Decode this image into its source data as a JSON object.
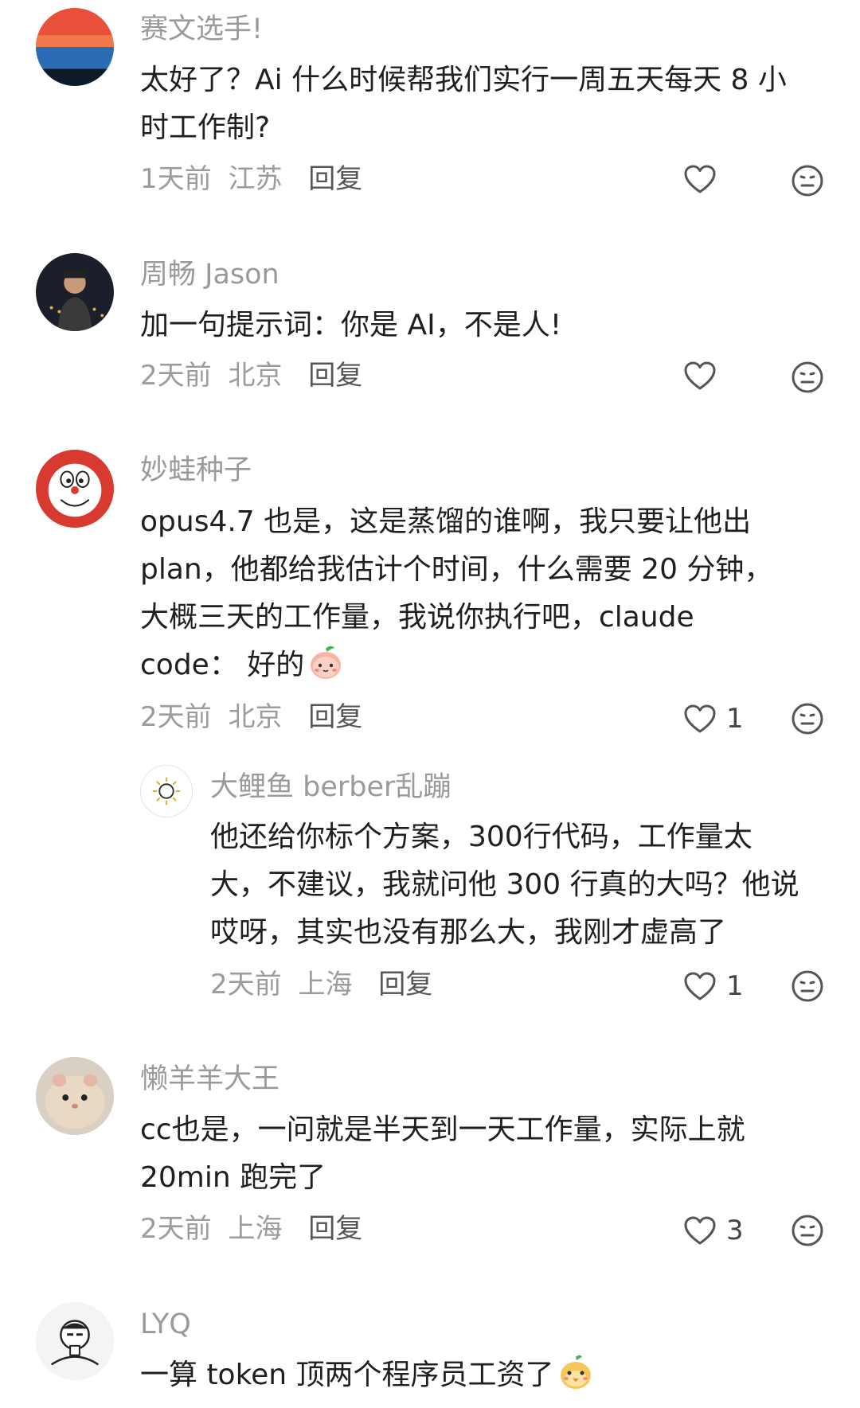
{
  "comments": [
    {
      "username": "赛文选手!",
      "content": "太好了？Ai 什么时候帮我们实行一周五天每天 8 小\n时工作制?",
      "time": "1天前",
      "location": "江苏",
      "reply_label": "回复",
      "likes": ""
    },
    {
      "username": "周畅 Jason",
      "content": "加一句提示词：你是 AI，不是人!",
      "time": "2天前",
      "location": "北京",
      "reply_label": "回复",
      "likes": ""
    },
    {
      "username": "妙蛙种子",
      "content": "opus4.7 也是，这是蒸馏的谁啊，我只要让他出\nplan，他都给我估计个时间，什么需要 20 分钟，\n大概三天的工作量，我说你执行吧，claude\ncode： 好的",
      "time": "2天前",
      "location": "北京",
      "reply_label": "回复",
      "likes": "1"
    },
    {
      "username": "大鲤鱼 berber乱蹦",
      "content": "他还给你标个方案，300行代码，工作量太\n大，不建议，我就问他 300 行真的大吗？他说\n哎呀，其实也没有那么大，我刚才虚高了",
      "time": "2天前",
      "location": "上海",
      "reply_label": "回复",
      "likes": "1"
    },
    {
      "username": "懒羊羊大王",
      "content": "cc也是，一问就是半天到一天工作量，实际上就\n20min 跑完了",
      "time": "2天前",
      "location": "上海",
      "reply_label": "回复",
      "likes": "3"
    },
    {
      "username": "LYQ",
      "content": "一算 token 顶两个程序员工资了",
      "time": "",
      "location": "",
      "reply_label": "",
      "likes": ""
    }
  ],
  "icons": {
    "like": "heart-outline-icon",
    "dislike": "neutral-face-icon"
  },
  "colors": {
    "username": "#9a9a9a",
    "text": "#1f1f1f",
    "meta": "#9c9c9c"
  }
}
